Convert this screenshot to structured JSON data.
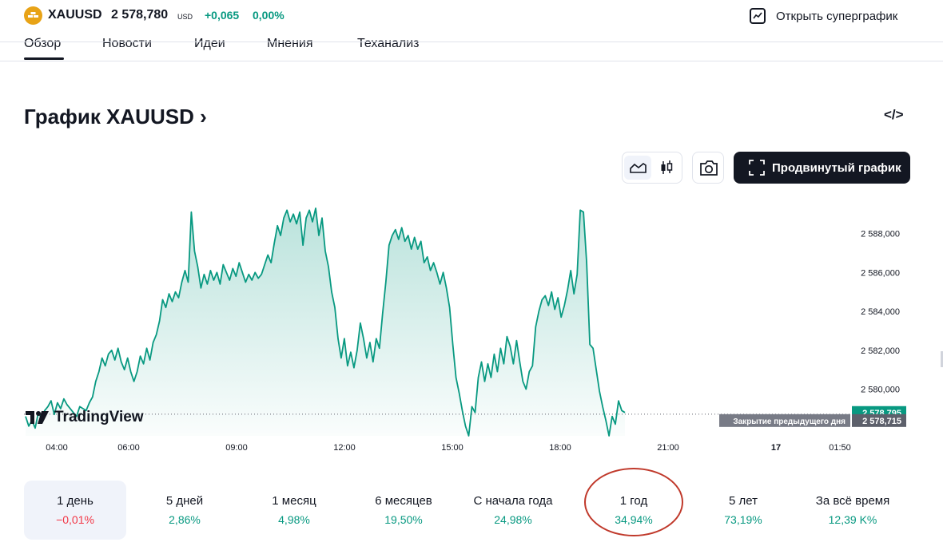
{
  "header": {
    "symbol": "XAUUSD",
    "price": "2 578,780",
    "currency": "USD",
    "change": "+0,065",
    "change_percent": "0,00%",
    "supergraph_label": "Открыть суперграфик"
  },
  "tabs": [
    {
      "label": "Обзор",
      "active": true
    },
    {
      "label": "Новости"
    },
    {
      "label": "Идеи"
    },
    {
      "label": "Мнения"
    },
    {
      "label": "Теханализ"
    }
  ],
  "title": "График XAUUSD",
  "title_chevron": "›",
  "embed_label": "</>",
  "advanced_chart_label": "Продвинутый график",
  "watermark": "TradingView",
  "colors": {
    "accent": "#089981",
    "negative": "#f23645",
    "dark": "#131722",
    "annotation_circle": "#c0392b"
  },
  "chart_data": {
    "type": "area",
    "x_ticks": [
      "04:00",
      "06:00",
      "09:00",
      "12:00",
      "15:00",
      "18:00",
      "21:00",
      "17",
      "01:50"
    ],
    "y_ticks": [
      "2 580,000",
      "2 582,000",
      "2 584,000",
      "2 586,000",
      "2 588,000"
    ],
    "ylim": [
      2577.6,
      2589.5
    ],
    "last_value_label": "2 578,795",
    "prev_close": 2578.715,
    "prev_close_label": "Закрытие предыдущего дня",
    "prev_close_value_label": "2 578,715",
    "series": [
      {
        "values": [
          2578.6,
          2578.1,
          2578.4,
          2578.0,
          2578.8,
          2578.5,
          2578.9,
          2579.1,
          2579.4,
          2578.7,
          2579.3,
          2579.0,
          2579.5,
          2579.2,
          2579.0,
          2578.8,
          2578.6,
          2579.1,
          2579.0,
          2578.9,
          2579.3,
          2579.6,
          2580.4,
          2580.9,
          2581.6,
          2581.2,
          2581.8,
          2582.0,
          2581.5,
          2582.1,
          2581.4,
          2581.0,
          2581.6,
          2580.9,
          2580.4,
          2580.9,
          2581.7,
          2581.3,
          2582.1,
          2581.5,
          2582.4,
          2582.8,
          2583.5,
          2584.6,
          2584.2,
          2584.9,
          2584.5,
          2585.0,
          2584.7,
          2585.5,
          2586.1,
          2585.5,
          2589.1,
          2587.1,
          2586.3,
          2585.2,
          2585.9,
          2585.4,
          2586.1,
          2585.6,
          2586.0,
          2585.4,
          2586.4,
          2586.0,
          2585.6,
          2586.2,
          2585.8,
          2586.5,
          2586.0,
          2585.5,
          2585.9,
          2585.6,
          2586.0,
          2585.7,
          2585.9,
          2586.4,
          2586.9,
          2586.5,
          2587.5,
          2588.4,
          2587.9,
          2588.8,
          2589.2,
          2588.6,
          2589.0,
          2588.5,
          2589.1,
          2587.4,
          2588.8,
          2589.2,
          2588.6,
          2589.3,
          2587.9,
          2588.8,
          2587.1,
          2586.3,
          2585.0,
          2584.2,
          2582.6,
          2581.6,
          2582.6,
          2581.2,
          2581.9,
          2581.1,
          2582.0,
          2583.4,
          2582.6,
          2581.6,
          2582.4,
          2581.4,
          2582.6,
          2582.1,
          2583.9,
          2585.5,
          2587.4,
          2587.9,
          2588.2,
          2587.7,
          2588.3,
          2587.6,
          2587.9,
          2587.2,
          2587.8,
          2587.2,
          2587.6,
          2586.5,
          2586.8,
          2586.1,
          2586.5,
          2586.0,
          2585.4,
          2586.0,
          2585.2,
          2584.2,
          2582.3,
          2580.6,
          2579.8,
          2578.9,
          2578.1,
          2577.6,
          2579.1,
          2578.8,
          2580.6,
          2581.4,
          2580.4,
          2581.3,
          2580.6,
          2581.8,
          2580.9,
          2582.1,
          2581.3,
          2582.7,
          2582.2,
          2581.3,
          2582.5,
          2581.4,
          2580.4,
          2580.0,
          2580.9,
          2581.2,
          2583.2,
          2584.0,
          2584.6,
          2584.8,
          2584.3,
          2585.0,
          2584.1,
          2584.7,
          2583.7,
          2584.3,
          2585.1,
          2586.1,
          2584.9,
          2585.9,
          2589.2,
          2589.1,
          2586.5,
          2582.3,
          2582.1,
          2581.0,
          2579.9,
          2579.1,
          2578.4,
          2577.6,
          2578.6,
          2578.2,
          2579.4,
          2578.9,
          2578.8
        ]
      }
    ]
  },
  "periods": [
    {
      "label": "1 день",
      "value": "−0,01%",
      "sign": "neg",
      "active": true
    },
    {
      "label": "5 дней",
      "value": "2,86%",
      "sign": "pos"
    },
    {
      "label": "1 месяц",
      "value": "4,98%",
      "sign": "pos"
    },
    {
      "label": "6 месяцев",
      "value": "19,50%",
      "sign": "pos"
    },
    {
      "label": "С начала года",
      "value": "24,98%",
      "sign": "pos"
    },
    {
      "label": "1 год",
      "value": "34,94%",
      "sign": "pos",
      "circled": true
    },
    {
      "label": "5 лет",
      "value": "73,19%",
      "sign": "pos"
    },
    {
      "label": "За всё время",
      "value": "12,39 K%",
      "sign": "pos"
    }
  ]
}
